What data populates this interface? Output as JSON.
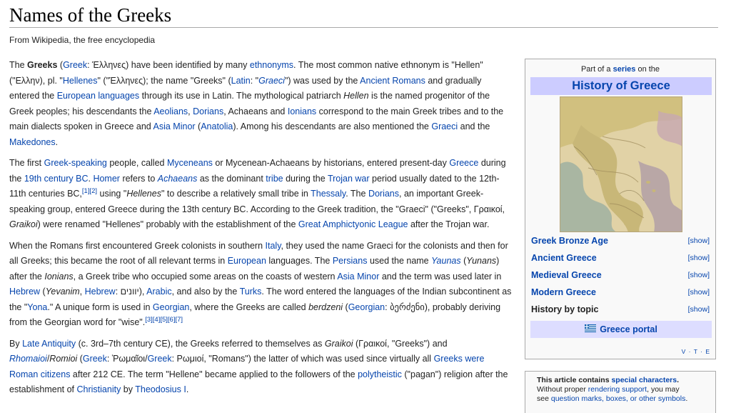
{
  "page": {
    "title": "Names of the Greeks",
    "subtitle": "From Wikipedia, the free encyclopedia"
  },
  "article": {
    "paragraphs": [
      [
        {
          "t": "The "
        },
        {
          "t": "Greeks",
          "b": true
        },
        {
          "t": " ("
        },
        {
          "t": "Greek",
          "l": true
        },
        {
          "t": ": Έλληνες) have been identified by many "
        },
        {
          "t": "ethnonyms",
          "l": true
        },
        {
          "t": ". The most common native ethnonym is \"Hellen\" (\"Ελλην), pl. \""
        },
        {
          "t": "Hellenes",
          "l": true
        },
        {
          "t": "\" (\"Έλληνες); the name \"Greeks\" ("
        },
        {
          "t": "Latin",
          "l": true
        },
        {
          "t": ": \""
        },
        {
          "t": "Graeci",
          "l": true,
          "i": true
        },
        {
          "t": "\") was used by the "
        },
        {
          "t": "Ancient Romans",
          "l": true
        },
        {
          "t": " and gradually entered the "
        },
        {
          "t": "European languages",
          "l": true
        },
        {
          "t": " through its use in Latin. The mythological patriarch "
        },
        {
          "t": "Hellen",
          "i": true
        },
        {
          "t": " is the named progenitor of the Greek peoples; his descendants the "
        },
        {
          "t": "Aeolians",
          "l": true
        },
        {
          "t": ", "
        },
        {
          "t": "Dorians",
          "l": true
        },
        {
          "t": ", Achaeans and "
        },
        {
          "t": "Ionians",
          "l": true
        },
        {
          "t": " correspond to the main Greek tribes and to the main dialects spoken in Greece and "
        },
        {
          "t": "Asia Minor",
          "l": true
        },
        {
          "t": " ("
        },
        {
          "t": "Anatolia",
          "l": true
        },
        {
          "t": "). Among his descendants are also mentioned the "
        },
        {
          "t": "Graeci",
          "l": true
        },
        {
          "t": " and the "
        },
        {
          "t": "Makedones",
          "l": true
        },
        {
          "t": "."
        }
      ],
      [
        {
          "t": "The first "
        },
        {
          "t": "Greek-speaking",
          "l": true
        },
        {
          "t": " people, called "
        },
        {
          "t": "Myceneans",
          "l": true
        },
        {
          "t": " or Mycenean-Achaeans by historians, entered present-day "
        },
        {
          "t": "Greece",
          "l": true
        },
        {
          "t": " during the "
        },
        {
          "t": "19th century BC",
          "l": true
        },
        {
          "t": ". "
        },
        {
          "t": "Homer",
          "l": true
        },
        {
          "t": " refers to "
        },
        {
          "t": "Achaeans",
          "l": true,
          "i": true
        },
        {
          "t": " as the dominant "
        },
        {
          "t": "tribe",
          "l": true
        },
        {
          "t": " during the "
        },
        {
          "t": "Trojan war",
          "l": true
        },
        {
          "t": " period usually dated to the 12th-11th centuries BC,"
        },
        {
          "t": "[1][2]",
          "l": true,
          "sup": true
        },
        {
          "t": " using \""
        },
        {
          "t": "Hellenes",
          "i": true
        },
        {
          "t": "\" to describe a relatively small tribe in "
        },
        {
          "t": "Thessaly",
          "l": true
        },
        {
          "t": ". The "
        },
        {
          "t": "Dorians",
          "l": true
        },
        {
          "t": ", an important Greek-speaking group, entered Greece during the 13th century BC. According to the Greek tradition, the \"Graeci\" (\"Greeks\", Γραικοί, "
        },
        {
          "t": "Graikoi",
          "i": true
        },
        {
          "t": ") were renamed \"Hellenes\" probably with the establishment of the "
        },
        {
          "t": "Great Amphictyonic League",
          "l": true
        },
        {
          "t": " after the Trojan war."
        }
      ],
      [
        {
          "t": "When the Romans first encountered Greek colonists in southern "
        },
        {
          "t": "Italy",
          "l": true
        },
        {
          "t": ", they used the name Graeci for the colonists and then for all Greeks; this became the root of all relevant terms in "
        },
        {
          "t": "European",
          "l": true
        },
        {
          "t": " languages. The "
        },
        {
          "t": "Persians",
          "l": true
        },
        {
          "t": " used the name "
        },
        {
          "t": "Yaunas",
          "l": true,
          "i": true
        },
        {
          "t": " ("
        },
        {
          "t": "Yunans",
          "i": true
        },
        {
          "t": ") after the "
        },
        {
          "t": "Ionians",
          "i": true
        },
        {
          "t": ", a Greek tribe who occupied some areas on the coasts of western "
        },
        {
          "t": "Asia Minor",
          "l": true
        },
        {
          "t": " and the term was used later in "
        },
        {
          "t": "Hebrew",
          "l": true
        },
        {
          "t": " ("
        },
        {
          "t": "Yevanim",
          "i": true
        },
        {
          "t": ", "
        },
        {
          "t": "Hebrew",
          "l": true
        },
        {
          "t": ": יוונים), "
        },
        {
          "t": "Arabic",
          "l": true
        },
        {
          "t": ", and also by the "
        },
        {
          "t": "Turks",
          "l": true
        },
        {
          "t": ". The word entered the languages of the Indian subcontinent as the \""
        },
        {
          "t": "Yona",
          "l": true
        },
        {
          "t": ".\" A unique form is used in "
        },
        {
          "t": "Georgian",
          "l": true
        },
        {
          "t": ", where the Greeks are called "
        },
        {
          "t": "berdzeni",
          "i": true
        },
        {
          "t": " ("
        },
        {
          "t": "Georgian",
          "l": true
        },
        {
          "t": ": ბერძენი), probably deriving from the Georgian word for \"wise\"."
        },
        {
          "t": "[3][4][5][6][7]",
          "l": true,
          "sup": true
        }
      ],
      [
        {
          "t": "By "
        },
        {
          "t": "Late Antiquity",
          "l": true
        },
        {
          "t": " (c. 3rd–7th century CE), the Greeks referred to themselves as "
        },
        {
          "t": "Graikoi",
          "i": true
        },
        {
          "t": " (Γραικοί, \"Greeks\") and "
        },
        {
          "t": "Rhomaioi",
          "l": true,
          "i": true
        },
        {
          "t": "/"
        },
        {
          "t": "Romioi",
          "i": true
        },
        {
          "t": " ("
        },
        {
          "t": "Greek",
          "l": true
        },
        {
          "t": ": Ῥωμαῖοι/"
        },
        {
          "t": "Greek",
          "l": true
        },
        {
          "t": ": Ρωμιοί, \"Romans\") the latter of which was used since virtually all "
        },
        {
          "t": "Greeks were Roman citizens",
          "l": true
        },
        {
          "t": " after 212 CE. The term \"Hellene\" became applied to the followers of the "
        },
        {
          "t": "polytheistic",
          "l": true
        },
        {
          "t": " (\"pagan\") religion after the establishment of "
        },
        {
          "t": "Christianity",
          "l": true
        },
        {
          "t": " by "
        },
        {
          "t": "Theodosius I",
          "l": true
        },
        {
          "t": "."
        }
      ]
    ]
  },
  "infobox": {
    "part_prefix": "Part of a ",
    "part_link": "series",
    "part_suffix": " on the",
    "title": "History of Greece",
    "rows": [
      {
        "label": "Greek Bronze Age",
        "link": true,
        "toggle": "[show]"
      },
      {
        "label": "Ancient Greece",
        "link": true,
        "toggle": "[show]"
      },
      {
        "label": "Medieval Greece",
        "link": true,
        "toggle": "[show]"
      },
      {
        "label": "Modern Greece",
        "link": true,
        "toggle": "[show]"
      },
      {
        "label": "History by topic",
        "link": false,
        "toggle": "[show]"
      }
    ],
    "portal": "Greece portal",
    "vte": "V · T · E"
  },
  "notice": {
    "bold_start": "This article contains ",
    "bold_link": "special characters",
    "bold_end": ".",
    "line2_start": "Without proper ",
    "line2_link": "rendering support",
    "line2_end": ", you may",
    "line3_start": "see ",
    "line3_link": "question marks, boxes, or other symbols",
    "line3_end": "."
  },
  "colors": {
    "link": "#0645ad",
    "text": "#222222",
    "infobox_header": "#ccccff",
    "portal_bar": "#ddddff",
    "infobox_bg": "#f9f9f9"
  }
}
